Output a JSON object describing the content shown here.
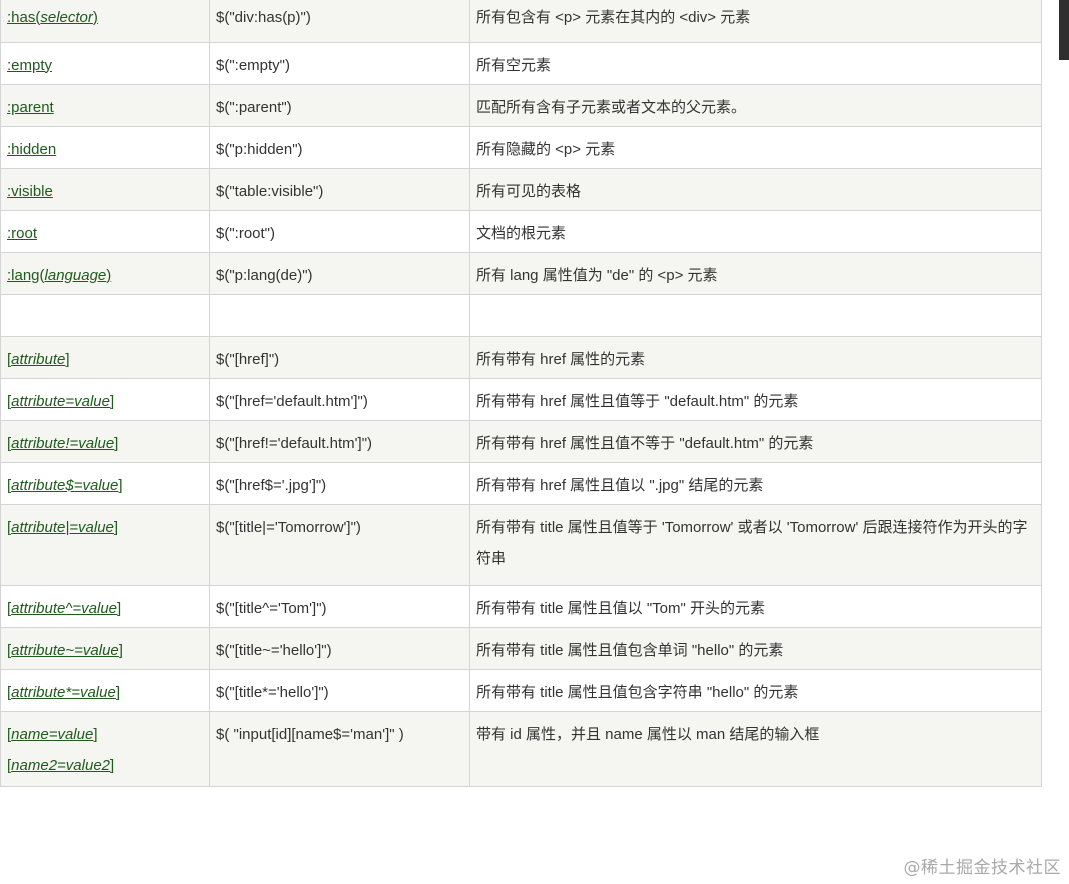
{
  "rows": [
    {
      "selector": [
        [
          ":has(",
          false
        ],
        [
          "selector",
          true
        ],
        [
          ")",
          false
        ]
      ],
      "example": "$(\"div:has(p)\")",
      "description": "所有包含有 <p> 元素在其内的 <div> 元素"
    },
    {
      "selector": [
        [
          ":empty",
          false
        ]
      ],
      "example": "$(\":empty\")",
      "description": "所有空元素"
    },
    {
      "selector": [
        [
          ":parent",
          false
        ]
      ],
      "example": "$(\":parent\")",
      "description": "匹配所有含有子元素或者文本的父元素。"
    },
    {
      "selector": [
        [
          ":hidden",
          false
        ]
      ],
      "example": "$(\"p:hidden\")",
      "description": "所有隐藏的 <p> 元素"
    },
    {
      "selector": [
        [
          ":visible",
          false
        ]
      ],
      "example": "$(\"table:visible\")",
      "description": "所有可见的表格"
    },
    {
      "selector": [
        [
          ":root",
          false
        ]
      ],
      "example": "$(\":root\")",
      "description": "文档的根元素"
    },
    {
      "selector": [
        [
          ":lang(",
          false
        ],
        [
          "language",
          true
        ],
        [
          ")",
          false
        ]
      ],
      "example": "$(\"p:lang(de)\")",
      "description": "所有 lang 属性值为 \"de\" 的 <p> 元素"
    },
    {
      "selector": [],
      "example": "",
      "description": ""
    },
    {
      "selector": [
        [
          "[",
          false
        ],
        [
          "attribute",
          true
        ],
        [
          "]",
          false
        ]
      ],
      "example": "$(\"[href]\")",
      "description": "所有带有 href 属性的元素"
    },
    {
      "selector": [
        [
          "[",
          false
        ],
        [
          "attribute=value",
          true
        ],
        [
          "]",
          false
        ]
      ],
      "example": "$(\"[href='default.htm']\")",
      "description": "所有带有 href 属性且值等于 \"default.htm\" 的元素"
    },
    {
      "selector": [
        [
          "[",
          false
        ],
        [
          "attribute!=value",
          true
        ],
        [
          "]",
          false
        ]
      ],
      "example": "$(\"[href!='default.htm']\")",
      "description": "所有带有 href 属性且值不等于 \"default.htm\" 的元素"
    },
    {
      "selector": [
        [
          "[",
          false
        ],
        [
          "attribute$=value",
          true
        ],
        [
          "]",
          false
        ]
      ],
      "example": "$(\"[href$='.jpg']\")",
      "description": "所有带有 href 属性且值以 \".jpg\" 结尾的元素"
    },
    {
      "selector": [
        [
          "[",
          false
        ],
        [
          "attribute|=value",
          true
        ],
        [
          "]",
          false
        ]
      ],
      "example": "$(\"[title|='Tomorrow']\")",
      "description": "所有带有 title 属性且值等于 'Tomorrow' 或者以 'Tomorrow' 后跟连接符作为开头的字符串"
    },
    {
      "selector": [
        [
          "[",
          false
        ],
        [
          "attribute^=value",
          true
        ],
        [
          "]",
          false
        ]
      ],
      "example": "$(\"[title^='Tom']\")",
      "description": "所有带有 title 属性且值以 \"Tom\" 开头的元素"
    },
    {
      "selector": [
        [
          "[",
          false
        ],
        [
          "attribute~=value",
          true
        ],
        [
          "]",
          false
        ]
      ],
      "example": "$(\"[title~='hello']\")",
      "description": "所有带有 title 属性且值包含单词 \"hello\" 的元素"
    },
    {
      "selector": [
        [
          "[",
          false
        ],
        [
          "attribute*=value",
          true
        ],
        [
          "]",
          false
        ]
      ],
      "example": "$(\"[title*='hello']\")",
      "description": "所有带有 title 属性且值包含字符串 \"hello\" 的元素"
    }
  ],
  "last_row": {
    "selector_lines": [
      [
        [
          "[",
          false
        ],
        [
          "name=value",
          true
        ],
        [
          "]",
          false
        ]
      ],
      [
        [
          "[",
          false
        ],
        [
          "name2=value2",
          true
        ],
        [
          "]",
          false
        ]
      ]
    ],
    "example": "$( \"input[id][name$='man']\" )",
    "description": "带有 id 属性，并且 name 属性以 man 结尾的输入框"
  },
  "watermark": "@稀土掘金技术社区"
}
